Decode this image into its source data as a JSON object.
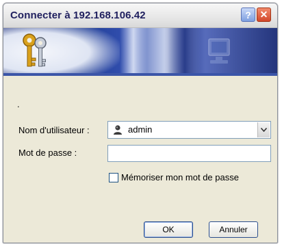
{
  "window": {
    "title": "Connecter à 192.168.106.42",
    "help_glyph": "?",
    "close_glyph": "✕"
  },
  "banner": {
    "icons": [
      "keys-icon",
      "computer-icon"
    ]
  },
  "body": {
    "intro_text": ".",
    "username": {
      "label": "Nom d'utilisateur :",
      "value": "admin",
      "icon": "user-icon"
    },
    "password": {
      "label": "Mot de passe :",
      "value": ""
    },
    "remember": {
      "label": "Mémoriser mon mot de passe",
      "checked": false
    }
  },
  "buttons": {
    "ok_label": "OK",
    "cancel_label": "Annuler"
  },
  "colors": {
    "title_text": "#1f1f5e",
    "banner_blue": "#1f3c94",
    "close_red": "#d2472a",
    "button_border": "#2a4d8c",
    "field_border": "#7f9db9"
  }
}
